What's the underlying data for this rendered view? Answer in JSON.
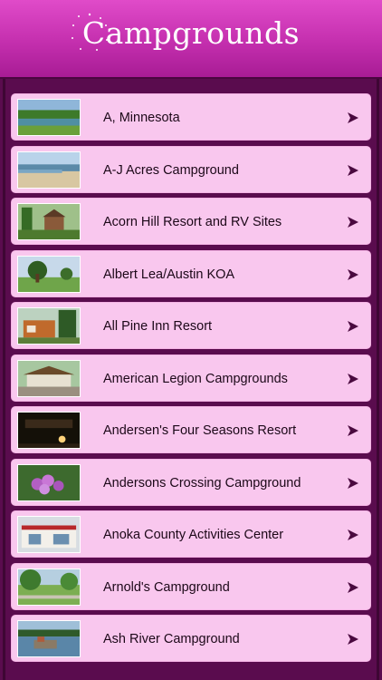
{
  "header": {
    "title": "Campgrounds"
  },
  "campgrounds": [
    {
      "name": "A, Minnesota",
      "thumb_icon": "lake-photo"
    },
    {
      "name": "A-J Acres Campground",
      "thumb_icon": "beach-photo"
    },
    {
      "name": "Acorn Hill Resort and RV Sites",
      "thumb_icon": "cabin-photo"
    },
    {
      "name": "Albert Lea/Austin KOA",
      "thumb_icon": "tree-field-photo"
    },
    {
      "name": "All Pine Inn Resort",
      "thumb_icon": "lodge-photo"
    },
    {
      "name": "American Legion Campgrounds",
      "thumb_icon": "pavilion-photo"
    },
    {
      "name": "Andersen's Four Seasons Resort",
      "thumb_icon": "night-sign-photo"
    },
    {
      "name": "Andersons Crossing Campground",
      "thumb_icon": "flowers-photo"
    },
    {
      "name": "Anoka County Activities Center",
      "thumb_icon": "building-photo"
    },
    {
      "name": "Arnold's Campground",
      "thumb_icon": "park-photo"
    },
    {
      "name": "Ash River Campground",
      "thumb_icon": "river-photo"
    }
  ],
  "colors": {
    "header": "#c42fae",
    "background": "#5a0c4e",
    "row": "#f9c7ee",
    "arrow": "#4a0a3f"
  }
}
